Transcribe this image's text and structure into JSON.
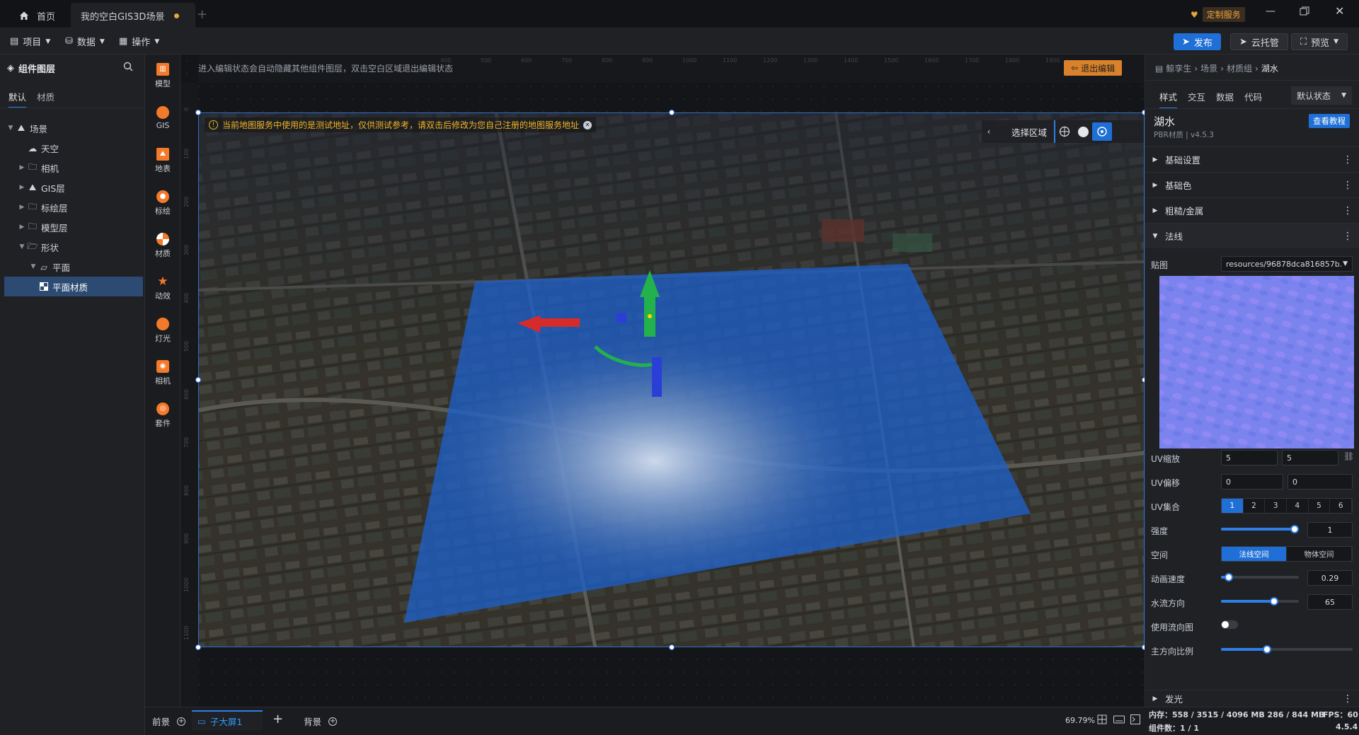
{
  "tabs": [
    {
      "label": "首页"
    },
    {
      "label": "我的空白GIS3D场景"
    }
  ],
  "window": {
    "custom_service": "定制服务"
  },
  "menu": {
    "project": "项目",
    "data": "数据",
    "operate": "操作"
  },
  "actions": {
    "publish": "发布",
    "cloud": "云托管",
    "preview": "预览"
  },
  "left_panel": {
    "title": "组件图层",
    "tabs": [
      "默认",
      "材质"
    ],
    "tree": [
      {
        "label": "场景"
      },
      {
        "label": "天空"
      },
      {
        "label": "相机"
      },
      {
        "label": "GIS层"
      },
      {
        "label": "标绘层"
      },
      {
        "label": "模型层"
      },
      {
        "label": "形状"
      },
      {
        "label": "平面"
      },
      {
        "label": "平面材质"
      }
    ]
  },
  "tools": [
    "模型",
    "GIS",
    "地表",
    "标绘",
    "材质",
    "动效",
    "灯光",
    "相机",
    "套件"
  ],
  "canvas": {
    "hint": "进入编辑状态会自动隐藏其他组件图层，双击空白区域退出编辑状态",
    "exit_edit": "退出编辑",
    "warning": "当前地图服务中使用的是测试地址，仅供测试参考，请双击后修改为您自己注册的地图服务地址",
    "select_area": "选择区域",
    "ruler_top": [
      "400",
      "500",
      "600",
      "700",
      "800",
      "900",
      "1000",
      "1100",
      "1200",
      "1300",
      "1400",
      "1500",
      "1600",
      "1700",
      "1800",
      "1900"
    ],
    "ruler_left": [
      "0",
      "100",
      "200",
      "300",
      "400",
      "500",
      "600",
      "700",
      "800",
      "900",
      "1000",
      "1100"
    ]
  },
  "right_panel": {
    "breadcrumb": [
      "鲸孪生",
      "场景",
      "材质组",
      "湖水"
    ],
    "tabs": [
      "样式",
      "交互",
      "数据",
      "代码"
    ],
    "state_select": "默认状态",
    "material_name": "湖水",
    "material_sub": "PBR材质 | v4.5.3",
    "tutorial": "查看教程",
    "sections": [
      "基础设置",
      "基础色",
      "粗糙/金属",
      "法线"
    ],
    "texture_label": "贴图",
    "texture_value": "resources/96878dca816857b...",
    "uv_scale_label": "UV缩放",
    "uv_scale": [
      "5",
      "5"
    ],
    "uv_offset_label": "UV偏移",
    "uv_offset": [
      "0",
      "0"
    ],
    "uv_set_label": "UV集合",
    "uv_set": [
      "1",
      "2",
      "3",
      "4",
      "5",
      "6"
    ],
    "strength_label": "强度",
    "strength": "1",
    "strength_level": 0.97,
    "space_label": "空间",
    "space_options": [
      "法线空间",
      "物体空间"
    ],
    "anim_speed_label": "动画速度",
    "anim_speed": "0.29",
    "anim_speed_level": 0.1,
    "flow_dir_label": "水流方向",
    "flow_dir": "65",
    "flow_dir_level": 0.68,
    "flow_map_label": "使用流向图",
    "main_ratio_label": "主方向比例",
    "main_ratio_level": 0.35,
    "next_section": "发光"
  },
  "bottom": {
    "front": "前景",
    "screen": "子大屏1",
    "background": "背景",
    "zoom": "69.79%"
  },
  "status": {
    "memory": "内存：558 / 3515 / 4096 MB  286 / 844 MB",
    "fps": "FPS：60",
    "count": "组件数：1 / 1",
    "version": "4.5.4"
  }
}
